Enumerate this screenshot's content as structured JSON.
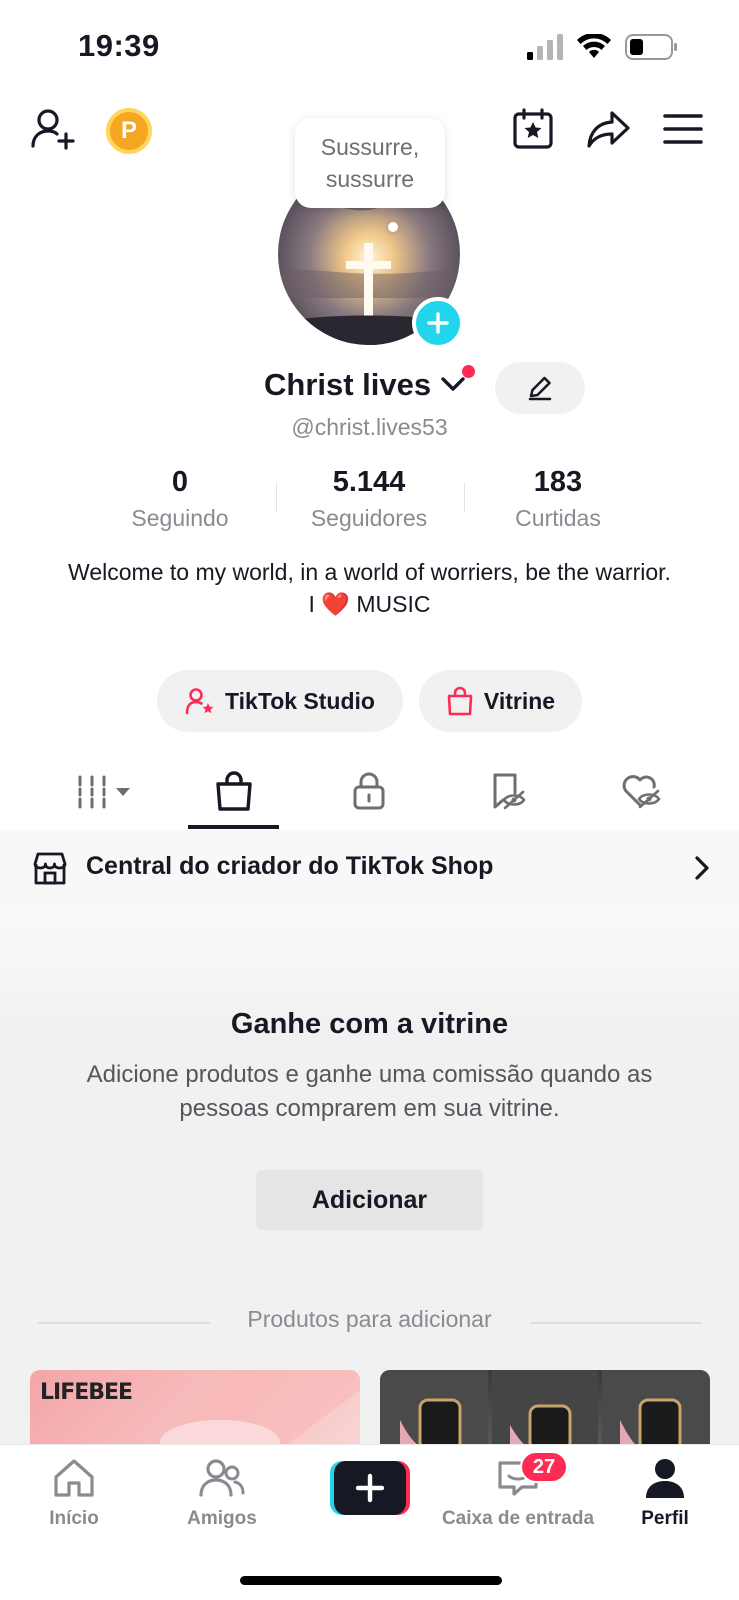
{
  "status_bar": {
    "time": "19:39"
  },
  "top_bar": {
    "coin_letter": "P"
  },
  "bubble": {
    "text": "Sussurre, sussurre"
  },
  "profile": {
    "display_name": "Christ lives",
    "handle": "@christ.lives53",
    "stats": [
      {
        "value": "0",
        "label": "Seguindo"
      },
      {
        "value": "5.144",
        "label": "Seguidores"
      },
      {
        "value": "183",
        "label": "Curtidas"
      }
    ],
    "bio_line1": "Welcome to my world, in a world of worriers, be the warrior.",
    "bio_line2_prefix": "I",
    "bio_heart": "❤️",
    "bio_line2_suffix": "MUSIC"
  },
  "actions": {
    "studio_label": "TikTok Studio",
    "vitrine_label": "Vitrine"
  },
  "shop_bar": {
    "label": "Central do criador do TikTok Shop"
  },
  "empty_state": {
    "title": "Ganhe com a vitrine",
    "description": "Adicione produtos e ganhe uma comissão quando as pessoas comprarem em sua vitrine.",
    "button": "Adicionar"
  },
  "products": {
    "section_label": "Produtos para adicionar",
    "card_a_brand": "LIFEBEE"
  },
  "bottom_nav": {
    "items": [
      {
        "label": "Início"
      },
      {
        "label": "Amigos"
      },
      {
        "label": "Caixa de entrada"
      },
      {
        "label": "Perfil"
      }
    ],
    "inbox_badge": "27"
  },
  "colors": {
    "accent": "#fe2c55",
    "cyan": "#20d5ec",
    "coin": "#f5a623"
  }
}
